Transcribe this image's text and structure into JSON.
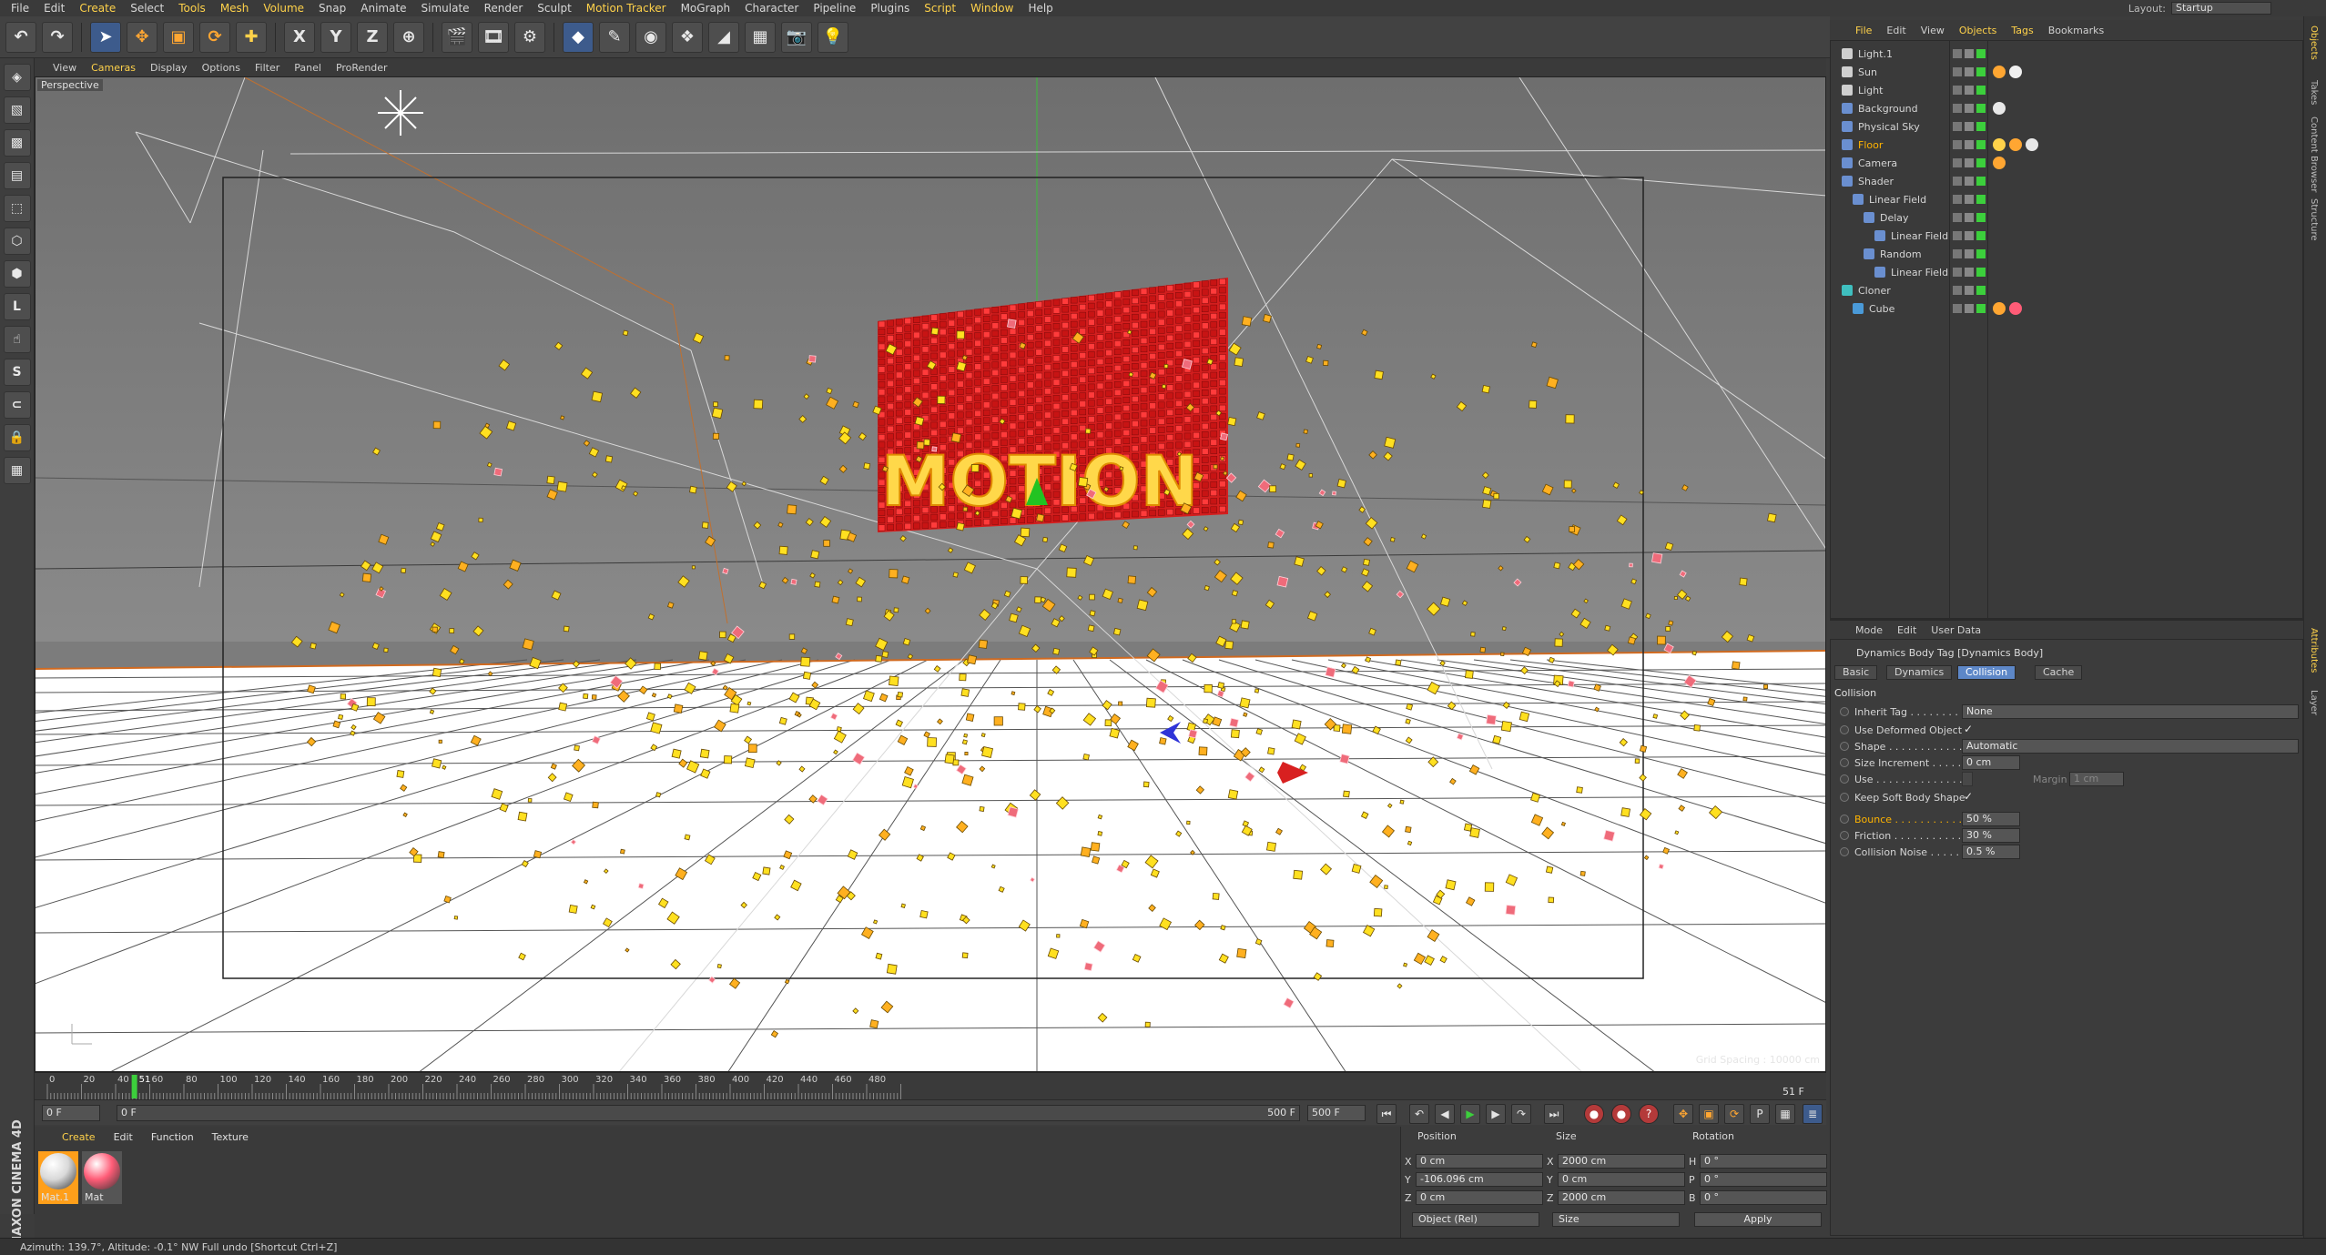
{
  "menubar": [
    "File",
    "Edit",
    "Create",
    "Select",
    "Tools",
    "Mesh",
    "Volume",
    "Snap",
    "Animate",
    "Simulate",
    "Render",
    "Sculpt",
    "Motion Tracker",
    "MoGraph",
    "Character",
    "Pipeline",
    "Plugins",
    "Script",
    "Window",
    "Help"
  ],
  "layout": {
    "label": "Layout:",
    "value": "Startup"
  },
  "toolbar": {
    "axis_x": "X",
    "axis_y": "Y",
    "axis_z": "Z"
  },
  "viewport_menu": [
    "View",
    "Cameras",
    "Display",
    "Options",
    "Filter",
    "Panel",
    "ProRender"
  ],
  "viewport": {
    "mode": "Perspective",
    "grid_spacing": "Grid Spacing : 10000 cm",
    "logo_text": "MOTION"
  },
  "timeline": {
    "ticks": [
      "0",
      "20",
      "40",
      "60",
      "80",
      "100",
      "120",
      "140",
      "160",
      "180",
      "200",
      "220",
      "240",
      "260",
      "280",
      "300",
      "320",
      "340",
      "360",
      "380",
      "400",
      "420",
      "440",
      "460",
      "480"
    ],
    "current_marker": "51",
    "current_frame": "51 F"
  },
  "transport": {
    "start": "0 F",
    "range_start": "0 F",
    "range_end": "500 F",
    "end": "500 F"
  },
  "materials": {
    "menu": [
      "Create",
      "Edit",
      "Function",
      "Texture"
    ],
    "items": [
      {
        "name": "Mat.1",
        "color": "#d9d9d9"
      },
      {
        "name": "Mat",
        "color": "#ff5c77"
      }
    ]
  },
  "brand": "MAXON CINEMA 4D",
  "coords": {
    "headers": {
      "position": "Position",
      "size": "Size",
      "rotation": "Rotation"
    },
    "rows": [
      {
        "axis": "X",
        "pos": "0 cm",
        "size_axis": "X",
        "size": "2000 cm",
        "rot_axis": "H",
        "rot": "0 °"
      },
      {
        "axis": "Y",
        "pos": "-106.096 cm",
        "size_axis": "Y",
        "size": "0 cm",
        "rot_axis": "P",
        "rot": "0 °"
      },
      {
        "axis": "Z",
        "pos": "0 cm",
        "size_axis": "Z",
        "size": "2000 cm",
        "rot_axis": "B",
        "rot": "0 °"
      }
    ],
    "mode": "Object (Rel)",
    "size_mode": "Size",
    "apply": "Apply"
  },
  "status": "Azimuth: 139.7°, Altitude: -0.1°  NW     Full undo [Shortcut Ctrl+Z]",
  "object_manager": {
    "menu": [
      "File",
      "Edit",
      "View",
      "Objects",
      "Tags",
      "Bookmarks"
    ],
    "objects": [
      {
        "name": "Light.1",
        "depth": 0,
        "color": "#cfcfcf"
      },
      {
        "name": "Sun",
        "depth": 0,
        "color": "#cfcfcf"
      },
      {
        "name": "Light",
        "depth": 0,
        "color": "#cfcfcf"
      },
      {
        "name": "Background",
        "depth": 0,
        "color": "#6a8fd0"
      },
      {
        "name": "Physical Sky",
        "depth": 0,
        "color": "#6a8fd0"
      },
      {
        "name": "Floor",
        "depth": 0,
        "color": "#6a8fd0"
      },
      {
        "name": "Camera",
        "depth": 0,
        "color": "#6a8fd0"
      },
      {
        "name": "Shader",
        "depth": 0,
        "color": "#6a8fd0"
      },
      {
        "name": "Linear Field",
        "depth": 1,
        "color": "#6a8fd0"
      },
      {
        "name": "Delay",
        "depth": 2,
        "color": "#6a8fd0"
      },
      {
        "name": "Linear Field",
        "depth": 3,
        "color": "#6a8fd0"
      },
      {
        "name": "Random",
        "depth": 2,
        "color": "#6a8fd0"
      },
      {
        "name": "Linear Field",
        "depth": 3,
        "color": "#6a8fd0"
      },
      {
        "name": "Cloner",
        "depth": 0,
        "color": "#3fbfbf"
      },
      {
        "name": "Cube",
        "depth": 1,
        "color": "#4a9ad8"
      }
    ]
  },
  "attributes": {
    "menu": [
      "Mode",
      "Edit",
      "User Data"
    ],
    "title": "Dynamics Body Tag [Dynamics Body]",
    "tabs": [
      "Basic",
      "Dynamics",
      "Collision",
      "Cache"
    ],
    "active_tab": "Collision",
    "section": "Collision",
    "rows": [
      {
        "label": "Inherit Tag . . . . . . . . .",
        "value": "None",
        "type": "dropdown"
      },
      {
        "label": "Use Deformed Object",
        "value": "✓",
        "type": "check"
      },
      {
        "label": "Shape . . . . . . . . . . . . .",
        "value": "Automatic",
        "type": "dropdown"
      },
      {
        "label": "Size Increment . . . . . .",
        "value": "0 cm",
        "type": "field"
      },
      {
        "label": "Use . . . . . . . . . . . . . .",
        "value": "",
        "type": "use",
        "margin_label": "Margin",
        "margin": "1 cm"
      },
      {
        "label": "Keep Soft Body Shape",
        "value": "✓",
        "type": "check"
      },
      {
        "label": "Bounce . . . . . . . . . . . .",
        "value": "50 %",
        "type": "field",
        "highlight": true
      },
      {
        "label": "Friction . . . . . . . . . . . .",
        "value": "30 %",
        "type": "field"
      },
      {
        "label": "Collision Noise . . . . . .",
        "value": "0.5 %",
        "type": "field"
      }
    ]
  },
  "side_tabs": [
    "Objects",
    "Takes",
    "Content Browser",
    "Structure",
    "Attributes",
    "Layer"
  ]
}
